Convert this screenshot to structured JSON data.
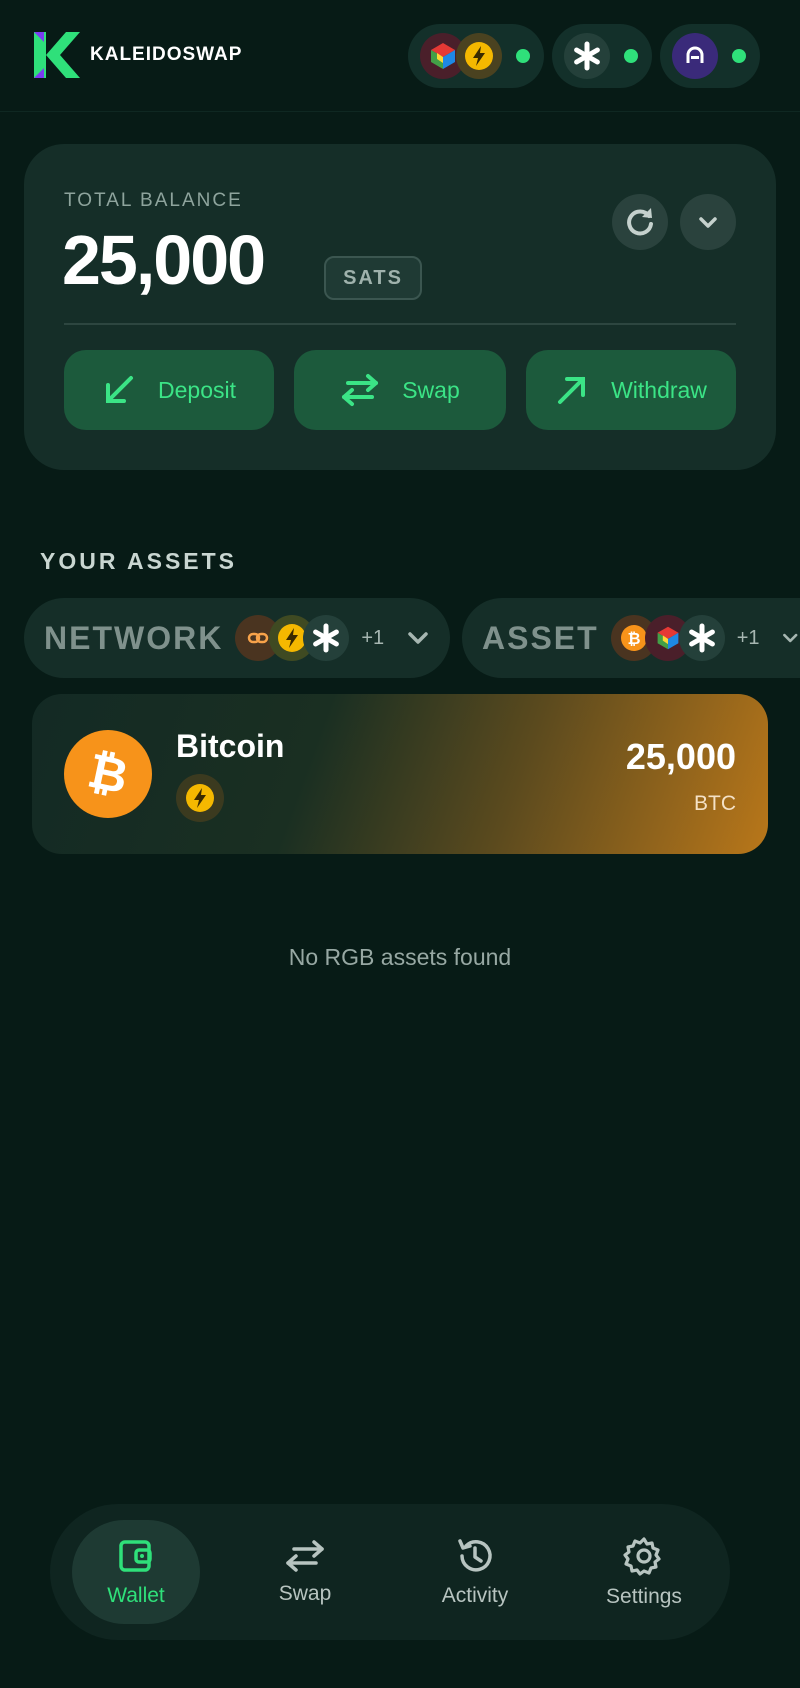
{
  "header": {
    "logo_text": "KALEIDOSWAP",
    "status_pills": [
      {
        "icons": [
          "rgb-cube-icon",
          "lightning-icon"
        ],
        "status_color": "#2fe07a"
      },
      {
        "icons": [
          "asterisk-icon"
        ],
        "status_color": "#2fe07a"
      },
      {
        "icons": [
          "node-icon"
        ],
        "status_color": "#2fe07a"
      }
    ]
  },
  "balance": {
    "label": "TOTAL BALANCE",
    "value": "25,000",
    "unit": "SATS",
    "actions": [
      {
        "label": "Deposit",
        "icon": "arrow-down-left-icon"
      },
      {
        "label": "Swap",
        "icon": "swap-arrows-icon"
      },
      {
        "label": "Withdraw",
        "icon": "arrow-up-right-icon"
      }
    ]
  },
  "assets": {
    "title": "YOUR ASSETS",
    "filters": [
      {
        "label": "NETWORK",
        "extra": "+1",
        "icons": [
          "chain-icon",
          "lightning-icon",
          "asterisk-icon"
        ]
      },
      {
        "label": "ASSET",
        "extra": "+1",
        "icons": [
          "bitcoin-icon",
          "rgb-cube-icon",
          "asterisk-icon"
        ]
      }
    ],
    "items": [
      {
        "name": "Bitcoin",
        "amount": "25,000",
        "unit": "BTC",
        "network_icon": "lightning-icon"
      }
    ],
    "empty_message": "No RGB assets found"
  },
  "nav": {
    "items": [
      {
        "label": "Wallet",
        "icon": "wallet-icon",
        "active": true
      },
      {
        "label": "Swap",
        "icon": "swap-arrows-icon",
        "active": false
      },
      {
        "label": "Activity",
        "icon": "history-icon",
        "active": false
      },
      {
        "label": "Settings",
        "icon": "gear-icon",
        "active": false
      }
    ]
  },
  "colors": {
    "background": "#071b16",
    "accent": "#2fe07a",
    "card": "#152e28",
    "bitcoin": "#f7931a",
    "lightning": "#f5b800"
  }
}
